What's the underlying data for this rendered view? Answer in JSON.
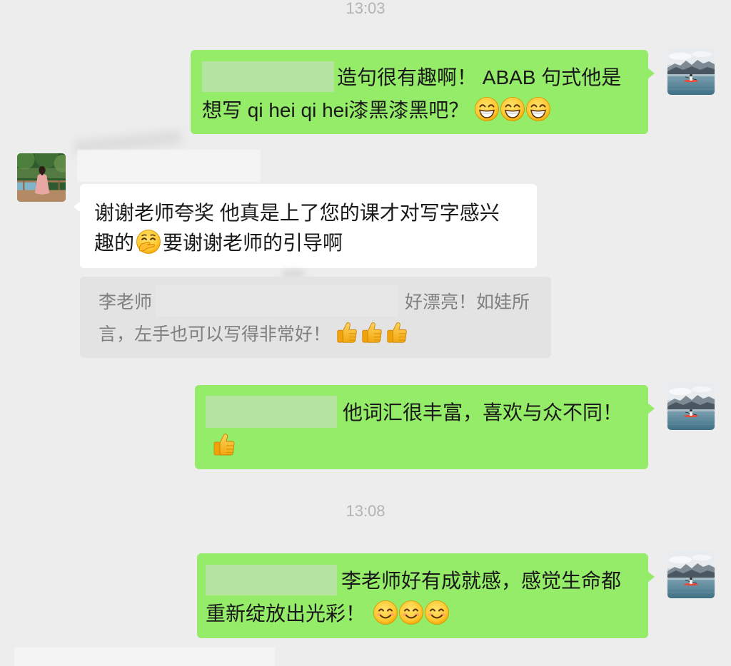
{
  "colors": {
    "page_background": "#ededed",
    "bubble_self": "#95ec69",
    "bubble_other": "#ffffff",
    "quote_background": "#e3e3e3",
    "redaction": "#b5e3a0",
    "timestamp_text": "#b3b3b3",
    "quote_text": "#7f7f7f"
  },
  "timestamps": [
    "13:03",
    "13:08"
  ],
  "avatars": {
    "self": "landscape-kayak-avatar",
    "other": "woman-seated-avatar"
  },
  "messages": [
    {
      "sender": "self",
      "lines": [
        {
          "text": "造句很有趣啊！ ABAB 句式他是"
        },
        {
          "text": "想写 qi hei qi hei漆黑漆黑吧？",
          "emojis": [
            "beaming-face-icon",
            "beaming-face-icon",
            "beaming-face-icon"
          ]
        }
      ]
    },
    {
      "sender": "other",
      "lines": [
        {
          "text": "谢谢老师夸奖 他真是上了您的课才对写字感兴"
        },
        {
          "text_before": "趣的",
          "emoji": "face-with-hand-over-mouth-icon",
          "text_after": "要谢谢老师的引导啊"
        }
      ],
      "quote": {
        "author": "李老师",
        "lines": [
          "好漂亮！如娃所",
          "言，左手也可以写得非常好！"
        ],
        "emojis": [
          "thumbs-up-icon",
          "thumbs-up-icon",
          "thumbs-up-icon"
        ]
      }
    },
    {
      "sender": "self",
      "lines": [
        {
          "text": "他词汇很丰富，喜欢与众不同！"
        },
        {
          "emojis": [
            "thumbs-up-icon"
          ]
        }
      ]
    },
    {
      "sender": "self",
      "lines": [
        {
          "text": "李老师好有成就感，感觉生命都"
        },
        {
          "text": "重新绽放出光彩！",
          "emojis": [
            "smiling-face-icon",
            "smiling-face-icon",
            "smiling-face-icon"
          ]
        }
      ]
    }
  ]
}
